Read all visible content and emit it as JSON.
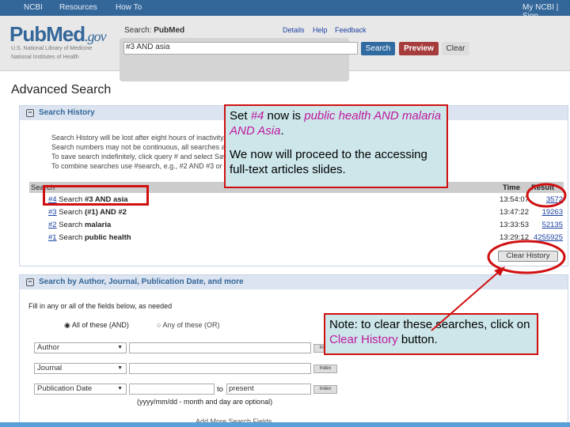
{
  "topbar": {
    "ncbi": "NCBI",
    "resources": "Resources",
    "howto": "How To",
    "account": "My NCBI | Sign"
  },
  "header": {
    "logo": "PubMed",
    "logo_suffix": ".gov",
    "line1": "U.S. National Library of Medicine",
    "line2": "National Institutes of Health",
    "search_label": "Search:",
    "search_db": "PubMed",
    "links": [
      "Details",
      "Help",
      "Feedback"
    ],
    "query": "#3 AND asia",
    "search_btn": "Search",
    "preview_btn": "Preview",
    "clear_btn": "Clear"
  },
  "page_title": "Advanced Search",
  "history": {
    "title": "Search History",
    "bullets": [
      "Search History will be lost after eight hours of inactivity.",
      "Search numbers may not be continuous, all searches are represented.",
      "To save search indefinitely, click query # and select Save in My NCBI.",
      "To combine searches use #search, e.g., #2 AND #3 or click query # for options."
    ],
    "col_search": "Search",
    "col_time": "Time",
    "col_result": "Result",
    "rows": [
      {
        "num": "#4",
        "label": "Search",
        "query": "#3 AND asia",
        "time": "13:54:07",
        "result": "3572"
      },
      {
        "num": "#3",
        "label": "Search",
        "query": "(#1) AND #2",
        "time": "13:47:22",
        "result": "19263"
      },
      {
        "num": "#2",
        "label": "Search",
        "query": "malaria",
        "time": "13:33:53",
        "result": "52135"
      },
      {
        "num": "#1",
        "label": "Search",
        "query": "public health",
        "time": "13:29:12",
        "result": "4255925"
      }
    ],
    "clear_history": "Clear History"
  },
  "builder": {
    "title": "Search by Author, Journal, Publication Date, and more",
    "intro": "Fill in any or all of the fields below, as needed",
    "radio_and": "All of these (AND)",
    "radio_or": "Any of these (OR)",
    "fields": [
      "Author",
      "Journal",
      "Publication Date"
    ],
    "index": "Index",
    "to": "to",
    "present": "present",
    "date_hint": "(yyyy/mm/dd - month and day are optional)",
    "add_more": "Add More Search Fields"
  },
  "callout1": {
    "p1_a": "Set ",
    "p1_b": "#4",
    "p1_c": " now is ",
    "p1_d": "public health AND malaria AND Asia",
    "p1_e": ".",
    "p2": "We now will proceed to the accessing full-text articles slides."
  },
  "callout2": {
    "a": "Note: to clear these searches, click on ",
    "b": "Clear History",
    "c": " button."
  },
  "colors": {
    "annotation_red": "#d01010",
    "callout_bg": "#cce6ea",
    "ncbi_blue": "#336699",
    "highlight": "#c0189c"
  }
}
